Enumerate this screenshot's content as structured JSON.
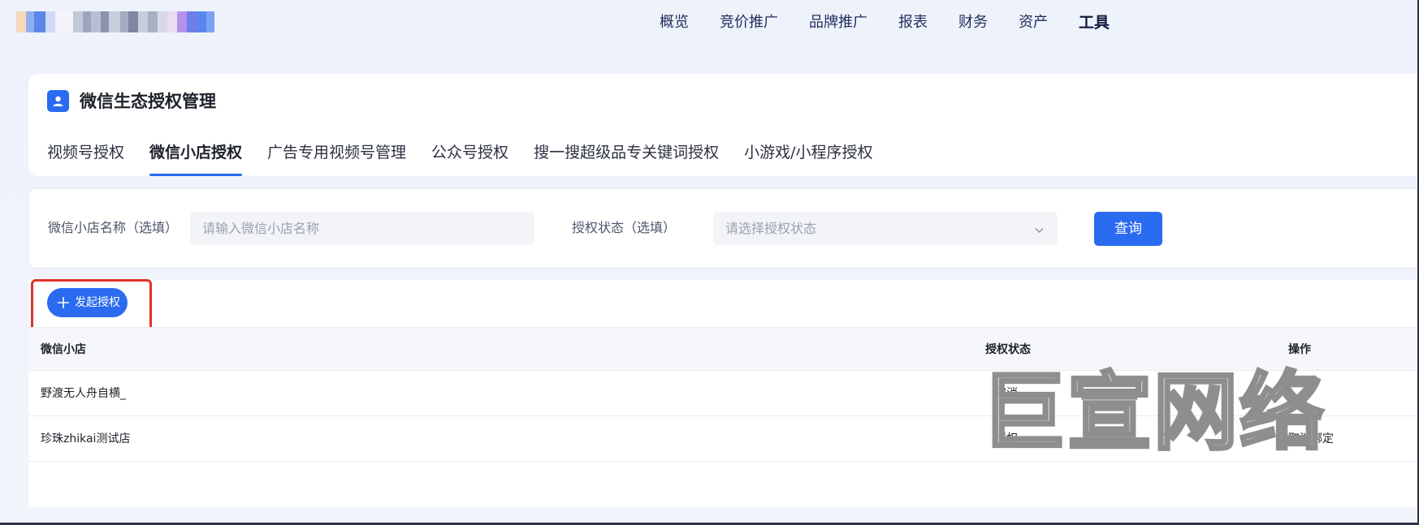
{
  "topnav": {
    "items": [
      {
        "label": "概览"
      },
      {
        "label": "竞价推广"
      },
      {
        "label": "品牌推广"
      },
      {
        "label": "报表"
      },
      {
        "label": "财务"
      },
      {
        "label": "资产"
      },
      {
        "label": "工具"
      }
    ],
    "active": "工具"
  },
  "header": {
    "title": "微信生态授权管理",
    "icon": "user-card-icon"
  },
  "tabs": [
    {
      "label": "视频号授权"
    },
    {
      "label": "微信小店授权"
    },
    {
      "label": "广告专用视频号管理"
    },
    {
      "label": "公众号授权"
    },
    {
      "label": "搜一搜超级品专关键词授权"
    },
    {
      "label": "小游戏/小程序授权"
    }
  ],
  "active_tab": "微信小店授权",
  "filters": {
    "shop_name_label": "微信小店名称（选填）",
    "shop_name_placeholder": "请输入微信小店名称",
    "status_label": "授权状态（选填）",
    "status_placeholder": "请选择授权状态",
    "query_label": "查询"
  },
  "actions": {
    "launch_label": "发起授权"
  },
  "table": {
    "columns": [
      "微信小店",
      "授权状态",
      "操作"
    ],
    "rows": [
      {
        "shop": "野渡无人舟自横_",
        "status": "取消",
        "action": ""
      },
      {
        "shop": "珍珠zhikai测试店",
        "status": "授权",
        "action": "取消绑定"
      }
    ]
  },
  "watermark": "巨宣网络",
  "colors": {
    "accent": "#2a6bf0",
    "highlight": "#e0332a"
  }
}
